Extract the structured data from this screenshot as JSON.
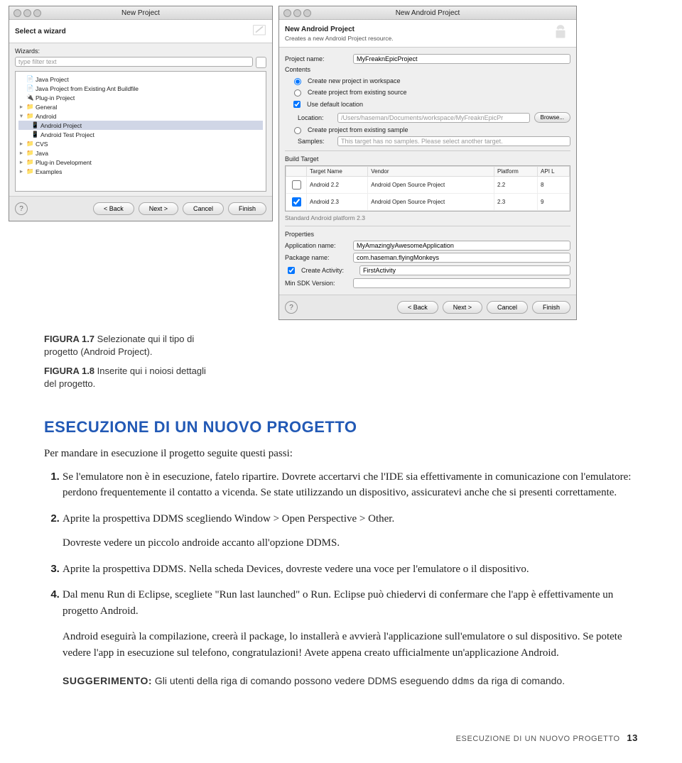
{
  "dialog1": {
    "title": "New Project",
    "header": "Select a wizard",
    "wizardsLabel": "Wizards:",
    "filter": "type filter text",
    "tree": {
      "r1": "Java Project",
      "r2": "Java Project from Existing Ant Buildfile",
      "r3": "Plug-in Project",
      "g1": "General",
      "g2": "Android",
      "g2a": "Android Project",
      "g2b": "Android Test Project",
      "g3": "CVS",
      "g4": "Java",
      "g5": "Plug-in Development",
      "g6": "Examples"
    },
    "btnBack": "< Back",
    "btnNext": "Next >",
    "btnCancel": "Cancel",
    "btnFinish": "Finish"
  },
  "dialog2": {
    "title": "New Android Project",
    "header": "New Android Project",
    "headerSub": "Creates a new Android Project resource.",
    "projNameLabel": "Project name:",
    "projName": "MyFreaknEpicProject",
    "contents": "Contents",
    "opt1": "Create new project in workspace",
    "opt2": "Create project from existing source",
    "opt3": "Use default location",
    "locationLabel": "Location:",
    "location": "/Users/haseman/Documents/workspace/MyFreaknEpicPr",
    "browse": "Browse...",
    "opt4": "Create project from existing sample",
    "samplesLabel": "Samples:",
    "samplesText": "This target has no samples. Please select another target.",
    "buildTarget": "Build Target",
    "thName": "Target Name",
    "thVendor": "Vendor",
    "thPlatform": "Platform",
    "thApi": "API L",
    "row1": {
      "name": "Android 2.2",
      "vendor": "Android Open Source Project",
      "plat": "2.2",
      "api": "8"
    },
    "row2": {
      "name": "Android 2.3",
      "vendor": "Android Open Source Project",
      "plat": "2.3",
      "api": "9"
    },
    "standard": "Standard Android platform 2.3",
    "properties": "Properties",
    "appNameLabel": "Application name:",
    "appName": "MyAmazinglyAwesomeApplication",
    "pkgLabel": "Package name:",
    "pkgName": "com.haseman.flyingMonkeys",
    "createActivity": "Create Activity:",
    "activity": "FirstActivity",
    "minSdk": "Min SDK Version:",
    "btnBack": "< Back",
    "btnNext": "Next >",
    "btnCancel": "Cancel",
    "btnFinish": "Finish"
  },
  "figure7": {
    "label": "FIGURA 1.7",
    "text": "Selezionate qui il tipo di progetto (Android Project)."
  },
  "figure8": {
    "label": "FIGURA 1.8",
    "text": "Inserite qui i noiosi dettagli del progetto."
  },
  "body": {
    "heading": "ESECUZIONE DI UN NUOVO PROGETTO",
    "intro": "Per mandare in esecuzione il progetto seguite questi passi:",
    "step1": "Se l'emulatore non è in esecuzione, fatelo ripartire. Dovrete accertarvi che l'IDE sia effettivamente in comunicazione con l'emulatore: perdono frequentemente il contatto a vicenda. Se state utilizzando un dispositivo, assicuratevi anche che si presenti correttamente.",
    "step2": "Aprite la prospettiva DDMS scegliendo Window > Open Perspective > Other.",
    "step2b": "Dovreste vedere un piccolo androide accanto all'opzione DDMS.",
    "step3": "Aprite la prospettiva DDMS. Nella scheda Devices, dovreste vedere una voce per l'emulatore o il dispositivo.",
    "step4": "Dal menu Run di Eclipse, scegliete \"Run last launched\" o Run. Eclipse può chiedervi di confermare che l'app è effettivamente un progetto Android.",
    "closing": "Android eseguirà la compilazione, creerà il package, lo installerà e avvierà l'applicazione sull'emulatore o sul dispositivo. Se potete vedere l'app in esecuzione sul telefono, congratulazioni! Avete appena creato ufficialmente un'applicazione Android.",
    "tipLabel": "SUGGERIMENTO:",
    "tipA": "Gli utenti della riga di comando possono vedere DDMS eseguendo ",
    "tipCmd": "ddms",
    "tipB": " da riga di comando."
  },
  "footer": {
    "text": "ESECUZIONE DI UN NUOVO PROGETTO",
    "page": "13"
  }
}
